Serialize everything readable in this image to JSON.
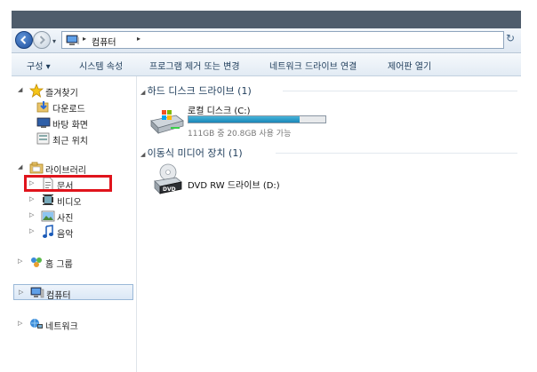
{
  "window": {
    "titlebar_color": "#4f5d6c"
  },
  "address": {
    "crumb": "컴퓨터",
    "separator": "▸",
    "recent_glyph": "▾",
    "dropdown_glyph": "▾",
    "refresh_glyph": "↻"
  },
  "toolbar": {
    "organize": "구성 ▾",
    "system_properties": "시스템 속성",
    "uninstall_program": "프로그램 제거 또는 변경",
    "map_network_drive": "네트워크 드라이브 연결",
    "control_panel": "제어판 열기"
  },
  "nav": {
    "favorites": {
      "label": "즐겨찾기",
      "items": [
        {
          "label": "다운로드",
          "icon": "download-folder-icon"
        },
        {
          "label": "바탕 화면",
          "icon": "desktop-icon"
        },
        {
          "label": "최근 위치",
          "icon": "recent-places-icon"
        }
      ]
    },
    "libraries": {
      "label": "라이브러리",
      "items": [
        {
          "label": "문서",
          "icon": "documents-icon"
        },
        {
          "label": "비디오",
          "icon": "videos-icon"
        },
        {
          "label": "사진",
          "icon": "pictures-icon"
        },
        {
          "label": "음악",
          "icon": "music-icon"
        }
      ]
    },
    "homegroup": {
      "label": "홈 그룹"
    },
    "computer": {
      "label": "컴퓨터"
    },
    "network": {
      "label": "네트워크"
    }
  },
  "main": {
    "hard_disks": {
      "header": "하드 디스크 드라이브 (1)",
      "drives": [
        {
          "name": "로컬 디스크 (C:)",
          "free_text": "111GB 중 20.8GB 사용 가능",
          "used_fraction": 0.81
        }
      ]
    },
    "removable": {
      "header": "이동식 미디어 장치 (1)",
      "drives": [
        {
          "name": "DVD RW 드라이브 (D:)"
        }
      ]
    }
  }
}
